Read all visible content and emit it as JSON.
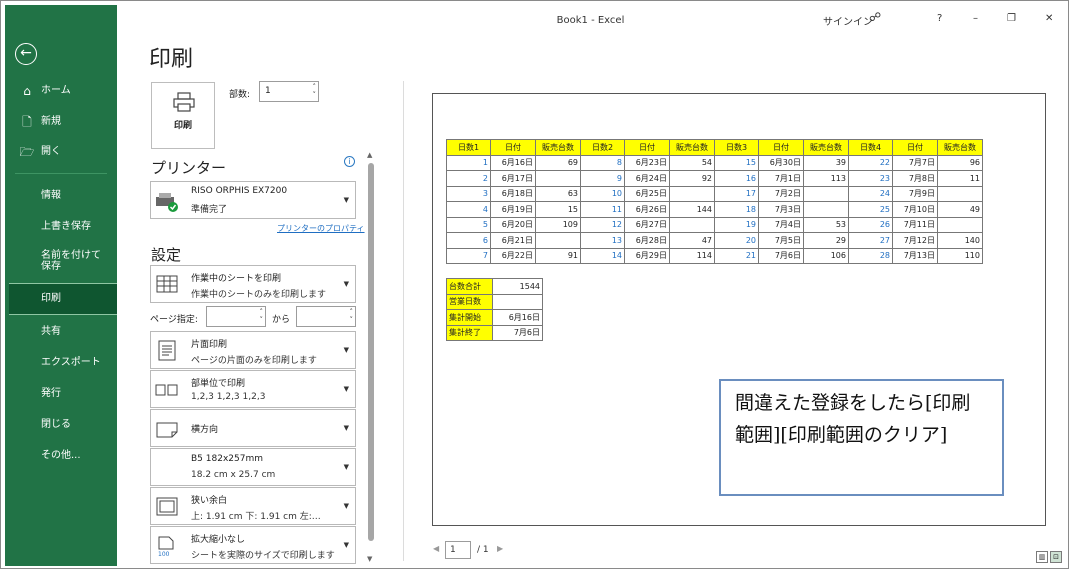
{
  "window": {
    "title": "Book1  -  Excel",
    "signin": "サインイン",
    "help": "?",
    "minimize": "–",
    "restore": "❐",
    "close": "✕"
  },
  "nav": {
    "back": "←",
    "items": [
      {
        "label": "ホーム",
        "icon": "home-icon"
      },
      {
        "label": "新規",
        "icon": "new-file-icon"
      },
      {
        "label": "開く",
        "icon": "folder-open-icon"
      },
      {
        "label": "情報"
      },
      {
        "label": "上書き保存"
      },
      {
        "label": "名前を付けて保存"
      },
      {
        "label": "印刷"
      },
      {
        "label": "共有"
      },
      {
        "label": "エクスポート"
      },
      {
        "label": "発行"
      },
      {
        "label": "閉じる"
      },
      {
        "label": "その他..."
      }
    ],
    "active": "印刷"
  },
  "print": {
    "heading": "印刷",
    "print_button": "印刷",
    "copies_label": "部数:",
    "copies_value": "1",
    "printer_title": "プリンター",
    "printer_name": "RISO ORPHIS EX7200",
    "printer_status": "準備完了",
    "printer_properties": "プリンターのプロパティ",
    "settings_title": "設定",
    "what_main": "作業中のシートを印刷",
    "what_sub": "作業中のシートのみを印刷します",
    "pages_label": "ページ指定:",
    "pages_to": "から",
    "sides_main": "片面印刷",
    "sides_sub": "ページの片面のみを印刷します",
    "collate_main": "部単位で印刷",
    "collate_sub": "1,2,3    1,2,3    1,2,3",
    "orientation": "横方向",
    "paper_main": "B5 182x257mm",
    "paper_sub": "18.2 cm x 25.7 cm",
    "margin_main": "狭い余白",
    "margin_sub": "上: 1.91 cm 下: 1.91 cm 左:…",
    "scale_main": "拡大縮小なし",
    "scale_sub": "シートを実際のサイズで印刷します"
  },
  "preview": {
    "headers": [
      "日数1",
      "日付",
      "販売台数",
      "日数2",
      "日付",
      "販売台数",
      "日数3",
      "日付",
      "販売台数",
      "日数4",
      "日付",
      "販売台数"
    ],
    "rows": [
      [
        "1",
        "6月16日",
        "69",
        "8",
        "6月23日",
        "54",
        "15",
        "6月30日",
        "39",
        "22",
        "7月7日",
        "96"
      ],
      [
        "2",
        "6月17日",
        "",
        "9",
        "6月24日",
        "92",
        "16",
        "7月1日",
        "113",
        "23",
        "7月8日",
        "11"
      ],
      [
        "3",
        "6月18日",
        "63",
        "10",
        "6月25日",
        "",
        "17",
        "7月2日",
        "",
        "24",
        "7月9日",
        ""
      ],
      [
        "4",
        "6月19日",
        "15",
        "11",
        "6月26日",
        "144",
        "18",
        "7月3日",
        "",
        "25",
        "7月10日",
        "49"
      ],
      [
        "5",
        "6月20日",
        "109",
        "12",
        "6月27日",
        "",
        "19",
        "7月4日",
        "53",
        "26",
        "7月11日",
        ""
      ],
      [
        "6",
        "6月21日",
        "",
        "13",
        "6月28日",
        "47",
        "20",
        "7月5日",
        "29",
        "27",
        "7月12日",
        "140"
      ],
      [
        "7",
        "6月22日",
        "91",
        "14",
        "6月29日",
        "114",
        "21",
        "7月6日",
        "106",
        "28",
        "7月13日",
        "110"
      ]
    ],
    "summary": [
      {
        "key": "台数合計",
        "value": "1544"
      },
      {
        "key": "営業日数",
        "value": ""
      },
      {
        "key": "集計開始",
        "value": "6月16日"
      },
      {
        "key": "集計終了",
        "value": "7月6日"
      }
    ],
    "callout": "間違えた登録をしたら[印刷範囲][印刷範囲のクリア]",
    "page_current": "1",
    "page_total": "/ 1"
  }
}
